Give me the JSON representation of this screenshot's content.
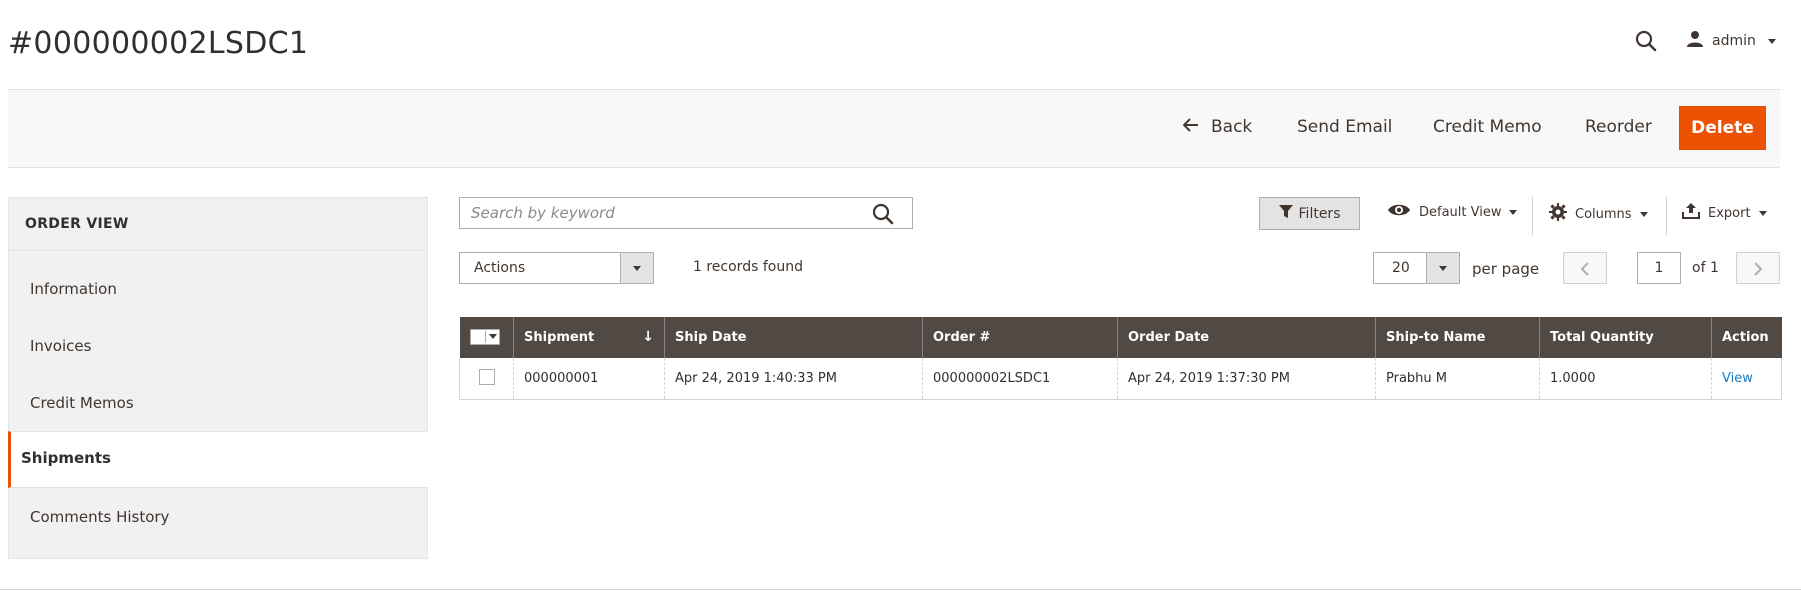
{
  "header": {
    "title": "#000000002LSDC1",
    "user": "admin"
  },
  "actionbar": {
    "back": "Back",
    "send_email": "Send Email",
    "credit_memo": "Credit Memo",
    "reorder": "Reorder",
    "delete": "Delete"
  },
  "sidebar": {
    "title": "ORDER VIEW",
    "items": [
      {
        "label": "Information"
      },
      {
        "label": "Invoices"
      },
      {
        "label": "Credit Memos"
      },
      {
        "label": "Shipments",
        "active": true
      },
      {
        "label": "Comments History"
      }
    ]
  },
  "toolbar": {
    "search_placeholder": "Search by keyword",
    "filters": "Filters",
    "default_view": "Default View",
    "columns": "Columns",
    "export": "Export",
    "actions": "Actions",
    "records_found": "1 records found",
    "per_page_value": "20",
    "per_page_label": "per page",
    "current_page": "1",
    "page_of": "of 1"
  },
  "grid": {
    "headers": [
      "Shipment",
      "Ship Date",
      "Order #",
      "Order Date",
      "Ship-to Name",
      "Total Quantity",
      "Action"
    ],
    "rows": [
      {
        "shipment": "000000001",
        "ship_date": "Apr 24, 2019 1:40:33 PM",
        "order_no": "000000002LSDC1",
        "order_date": "Apr 24, 2019 1:37:30 PM",
        "ship_to": "Prabhu M",
        "total_qty": "1.0000",
        "action": "View"
      }
    ],
    "sort_arrow": "↓"
  },
  "colors": {
    "accent": "#eb5202",
    "header_bg": "#514943",
    "link": "#1979c3"
  },
  "icons": {
    "search": "search-icon",
    "user": "user-icon",
    "back": "arrow-left-icon",
    "filter": "filter-icon",
    "view": "eye-icon",
    "columns": "gear-icon",
    "export": "export-icon"
  }
}
